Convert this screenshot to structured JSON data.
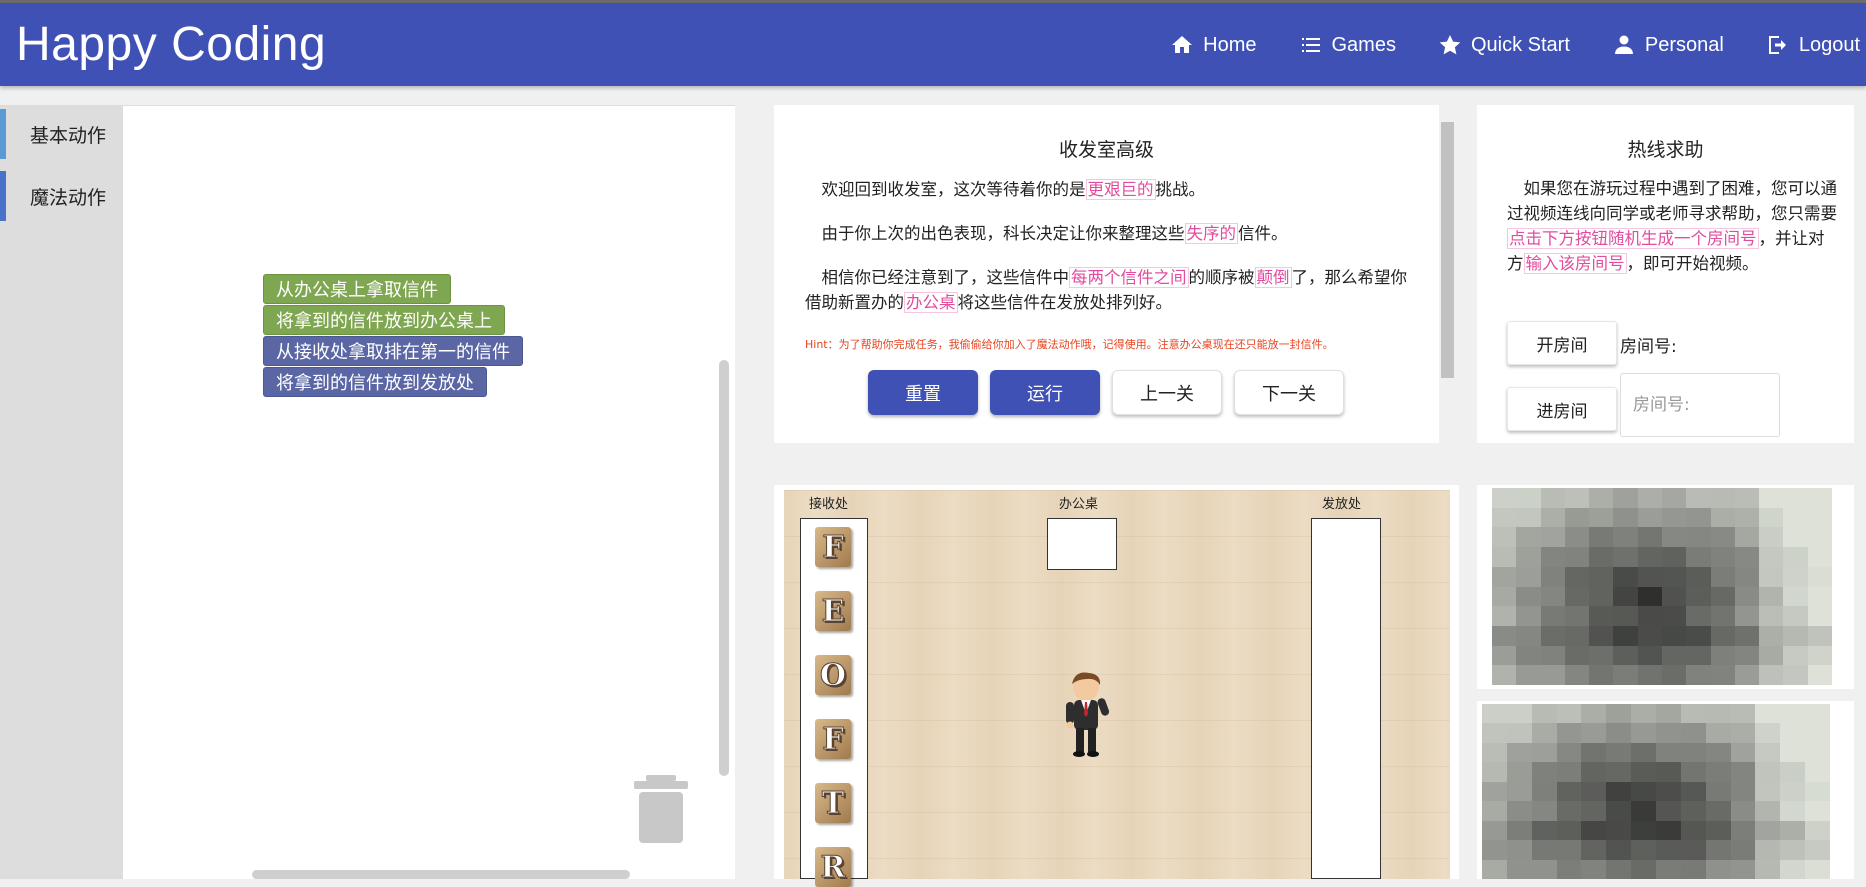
{
  "header": {
    "brand": "Happy Coding",
    "nav": [
      {
        "label": "Home",
        "icon": "home-icon"
      },
      {
        "label": "Games",
        "icon": "list-icon"
      },
      {
        "label": "Quick Start",
        "icon": "star-icon"
      },
      {
        "label": "Personal",
        "icon": "person-icon"
      },
      {
        "label": "Logout",
        "icon": "logout-icon"
      }
    ],
    "bg_color": "#3f51b5"
  },
  "categories": [
    {
      "label": "基本动作",
      "color": "#5b9bd5"
    },
    {
      "label": "魔法动作",
      "color": "#4a72c8"
    }
  ],
  "workspace": {
    "blocks": [
      {
        "label": "从办公桌上拿取信件",
        "color": "#7fa650"
      },
      {
        "label": "将拿到的信件放到办公桌上",
        "color": "#7fa650"
      },
      {
        "label": "从接收处拿取排在第一的信件",
        "color": "#5b67a5"
      },
      {
        "label": "将拿到的信件放到发放处",
        "color": "#5b67a5"
      }
    ]
  },
  "level": {
    "title": "收发室高级",
    "p1_before": "欢迎回到收发室，这次等待着你的是",
    "p1_hl": "更艰巨的",
    "p1_after": "挑战。",
    "p2_before": "由于你上次的出色表现，科长决定让你来整理这些",
    "p2_hl": "失序的",
    "p2_after": "信件。",
    "p3_a": "相信你已经注意到了，这些信件中",
    "p3_hl1": "每两个信件之间",
    "p3_b": "的顺序被",
    "p3_hl2": "颠倒",
    "p3_c": "了，那么希望你借助新置办的",
    "p3_hl3": "办公桌",
    "p3_d": "将这些信件在发放处排列好。",
    "hint": "Hint：为了帮助你完成任务，我偷偷给你加入了魔法动作哦，记得使用。注意办公桌现在还只能放一封信件。",
    "buttons": {
      "reset": "重置",
      "run": "运行",
      "prev": "上一关",
      "next": "下一关"
    }
  },
  "help": {
    "title": "热线求助",
    "text_before": "如果您在游玩过程中遇到了困难，您可以通过视频连线向同学或老师寻求帮助，您只需要",
    "text_hl1": "点击下方按钮随机生成一个房间号",
    "text_mid": "，并让对方",
    "text_hl2": "输入该房间号",
    "text_after": "，即可开始视频。",
    "open_room": "开房间",
    "join_room": "进房间",
    "room_label": "房间号:",
    "room_placeholder": "房间号:"
  },
  "game": {
    "labels": {
      "receive": "接收处",
      "desk": "办公桌",
      "dispatch": "发放处"
    },
    "letters": [
      "F",
      "E",
      "O",
      "F",
      "T",
      "R"
    ]
  }
}
